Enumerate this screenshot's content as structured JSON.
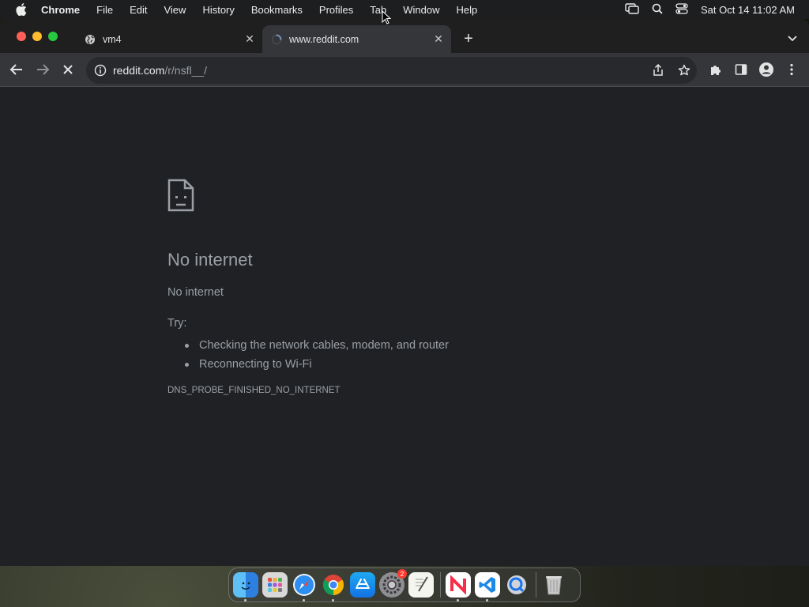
{
  "menubar": {
    "app_name": "Chrome",
    "items": [
      "File",
      "Edit",
      "View",
      "History",
      "Bookmarks",
      "Profiles",
      "Tab",
      "Window",
      "Help"
    ],
    "clock": "Sat Oct 14  11:02 AM"
  },
  "tabs": [
    {
      "title": "vm4",
      "favicon": "globe-icon",
      "active": false
    },
    {
      "title": "www.reddit.com",
      "favicon": "loading-spinner-icon",
      "active": true
    }
  ],
  "omnibox": {
    "domain": "reddit.com",
    "path": "/r/nsfl__/"
  },
  "error_page": {
    "title": "No internet",
    "subtitle": "No internet",
    "try_label": "Try:",
    "suggestions": [
      "Checking the network cables, modem, and router",
      "Reconnecting to Wi-Fi"
    ],
    "error_code": "DNS_PROBE_FINISHED_NO_INTERNET"
  },
  "dock": {
    "apps": [
      "finder-icon",
      "launchpad-icon",
      "safari-icon",
      "chrome-icon",
      "app-store-icon",
      "system-settings-icon",
      "textedit-icon",
      "news-icon",
      "vscode-icon",
      "quicktime-icon",
      "trash-icon"
    ],
    "settings_badge": "2"
  },
  "colors": {
    "page_bg": "#202124",
    "toolbar_bg": "#35363a",
    "text_muted": "#9aa0a6"
  }
}
